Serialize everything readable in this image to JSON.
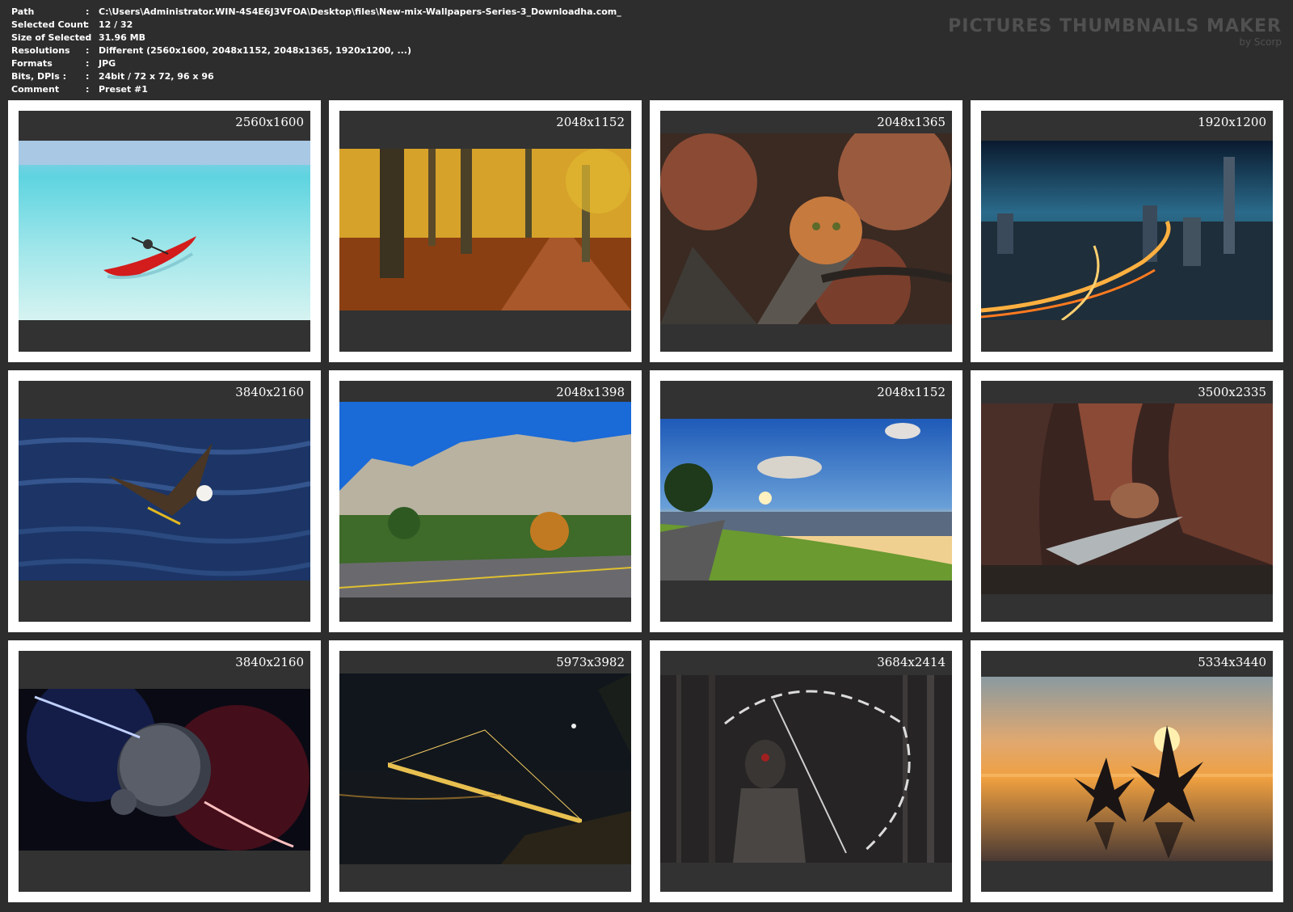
{
  "info": {
    "rows": [
      {
        "label": "Path",
        "value": "C:\\Users\\Administrator.WIN-4S4E6J3VFOA\\Desktop\\files\\New-mix-Wallpapers-Series-3_Downloadha.com_"
      },
      {
        "label": "Selected Count",
        "value": "12 / 32"
      },
      {
        "label": "Size of Selected",
        "value": "31.96 MB"
      },
      {
        "label": "Resolutions",
        "value": "Different (2560x1600, 2048x1152, 2048x1365, 1920x1200, ...)"
      },
      {
        "label": "Formats",
        "value": "JPG"
      },
      {
        "label": "Bits, DPIs :",
        "value": "24bit / 72 x 72, 96 x 96"
      },
      {
        "label": "Comment",
        "value": "Preset #1"
      }
    ],
    "separator": ":"
  },
  "brand": {
    "title": "PICTURES THUMBNAILS MAKER",
    "subtitle": "by Scorp"
  },
  "thumbnails": [
    {
      "resolution": "2560x1600",
      "scene": "turquoise-sea-red-kayak"
    },
    {
      "resolution": "2048x1152",
      "scene": "autumn-forest-path"
    },
    {
      "resolution": "2048x1365",
      "scene": "cat-in-autumn-tree"
    },
    {
      "resolution": "1920x1200",
      "scene": "city-highway-night"
    },
    {
      "resolution": "3840x2160",
      "scene": "eagle-over-water"
    },
    {
      "resolution": "2048x1398",
      "scene": "cliffs-and-road"
    },
    {
      "resolution": "2048x1152",
      "scene": "sunset-hill-path"
    },
    {
      "resolution": "3500x2335",
      "scene": "red-canyon-stream"
    },
    {
      "resolution": "3840x2160",
      "scene": "planets-space-fire"
    },
    {
      "resolution": "5973x3982",
      "scene": "night-bridge-lights"
    },
    {
      "resolution": "3684x2414",
      "scene": "dark-forest-warrior"
    },
    {
      "resolution": "5334x3440",
      "scene": "starfish-sunset-beach"
    }
  ],
  "colors": {
    "background": "#2d2d2d",
    "card_border": "#ffffff",
    "card_inner": "#323232",
    "brand_text": "#505050"
  }
}
